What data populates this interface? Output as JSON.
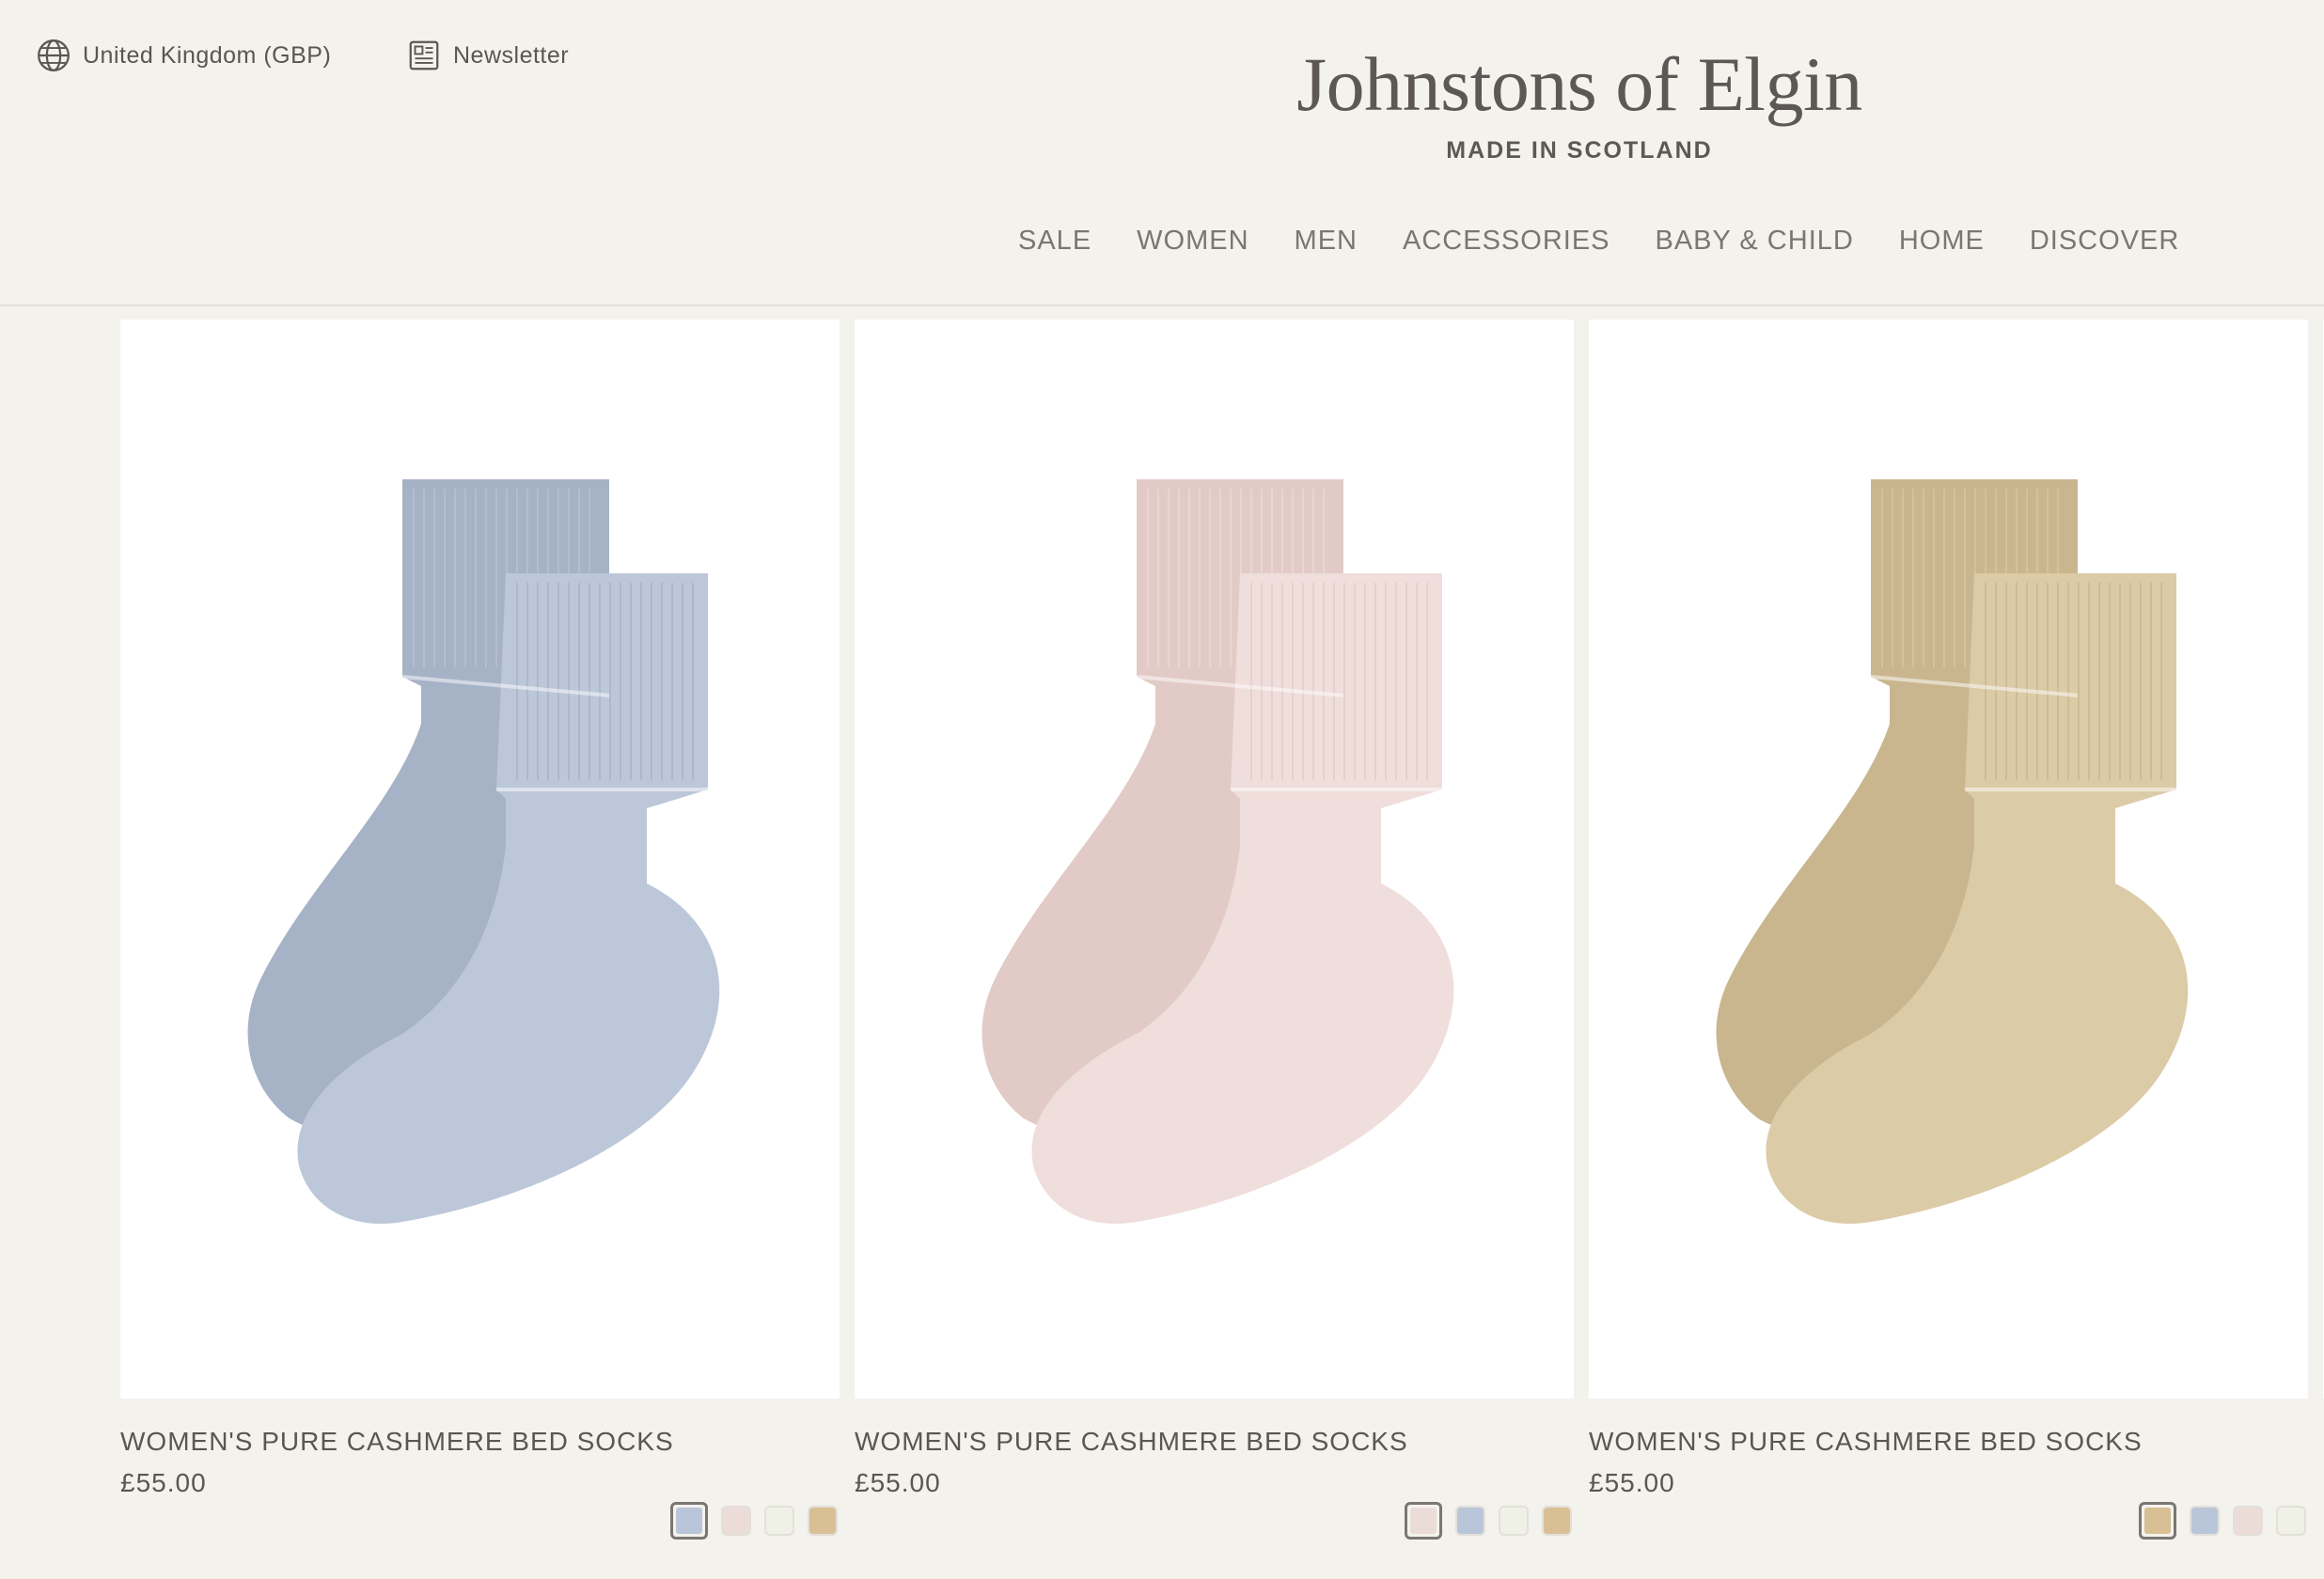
{
  "header": {
    "region_label": "United Kingdom (GBP)",
    "newsletter_label": "Newsletter",
    "brand_name": "Johnstons of Elgin",
    "brand_tagline": "MADE IN SCOTLAND",
    "nav": [
      "SALE",
      "WOMEN",
      "MEN",
      "ACCESSORIES",
      "BABY & CHILD",
      "HOME",
      "DISCOVER"
    ]
  },
  "products": [
    {
      "title": "WOMEN'S PURE CASHMERE BED SOCKS",
      "price": "£55.00",
      "sock_color": "#bcc7d9",
      "sock_shade": "#a6b2c6",
      "swatches": [
        "#b9c6d9",
        "#ecdcd8",
        "#eff0e6",
        "#d9bf94"
      ],
      "selected_swatch": 0
    },
    {
      "title": "WOMEN'S PURE CASHMERE BED SOCKS",
      "price": "£55.00",
      "sock_color": "#efdedb",
      "sock_shade": "#e2cbc6",
      "swatches": [
        "#ecdcd8",
        "#b9c6d9",
        "#eff0e6",
        "#d9bf94"
      ],
      "selected_swatch": 0
    },
    {
      "title": "WOMEN'S PURE CASHMERE BED SOCKS",
      "price": "£55.00",
      "sock_color": "#dccba7",
      "sock_shade": "#c9b68f",
      "swatches": [
        "#d9bf94",
        "#b9c6d9",
        "#ecdcd8",
        "#eff0e6"
      ],
      "selected_swatch": 0
    }
  ]
}
